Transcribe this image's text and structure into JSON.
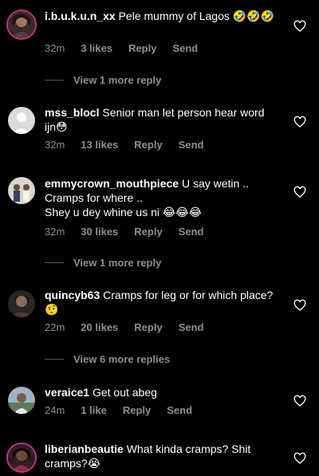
{
  "comments": [
    {
      "username": "i.b.u.k.u.n_xx",
      "text": "Pele mummy of Lagos",
      "emoji": "🤣🤣🤣",
      "time": "32m",
      "likes": "3 likes",
      "reply": "Reply",
      "send": "Send",
      "more_replies": "View 1 more reply"
    },
    {
      "username": "mss_blocl",
      "text": "Senior man let person hear word ijn",
      "emoji": "😳",
      "time": "32m",
      "likes": "13 likes",
      "reply": "Reply",
      "send": "Send"
    },
    {
      "username": "emmycrown_mouthpiece",
      "text": "U say wetin ..",
      "line2": "Cramps for where ..",
      "line3": "Shey u dey whine us ni",
      "emoji": "😂😂😂",
      "time": "32m",
      "likes": "30 likes",
      "reply": "Reply",
      "send": "Send",
      "more_replies": "View 1 more reply"
    },
    {
      "username": "quincyb63",
      "text": "Cramps for leg or for which place?",
      "emoji": "🤨",
      "time": "22m",
      "likes": "20 likes",
      "reply": "Reply",
      "send": "Send",
      "more_replies": "View 6 more replies"
    },
    {
      "username": "veraice1",
      "text": "Get out abeg",
      "time": "24m",
      "likes": "1 like",
      "reply": "Reply",
      "send": "Send"
    },
    {
      "username": "liberianbeautie",
      "text": "What kinda cramps? Shit cramps?",
      "emoji": "😭"
    }
  ],
  "icons": {
    "like": "heart-outline-icon"
  },
  "colors": {
    "background": "#000000",
    "text": "#ffffff",
    "secondary": "#8e8e8e",
    "story_ring": "#c13584"
  }
}
